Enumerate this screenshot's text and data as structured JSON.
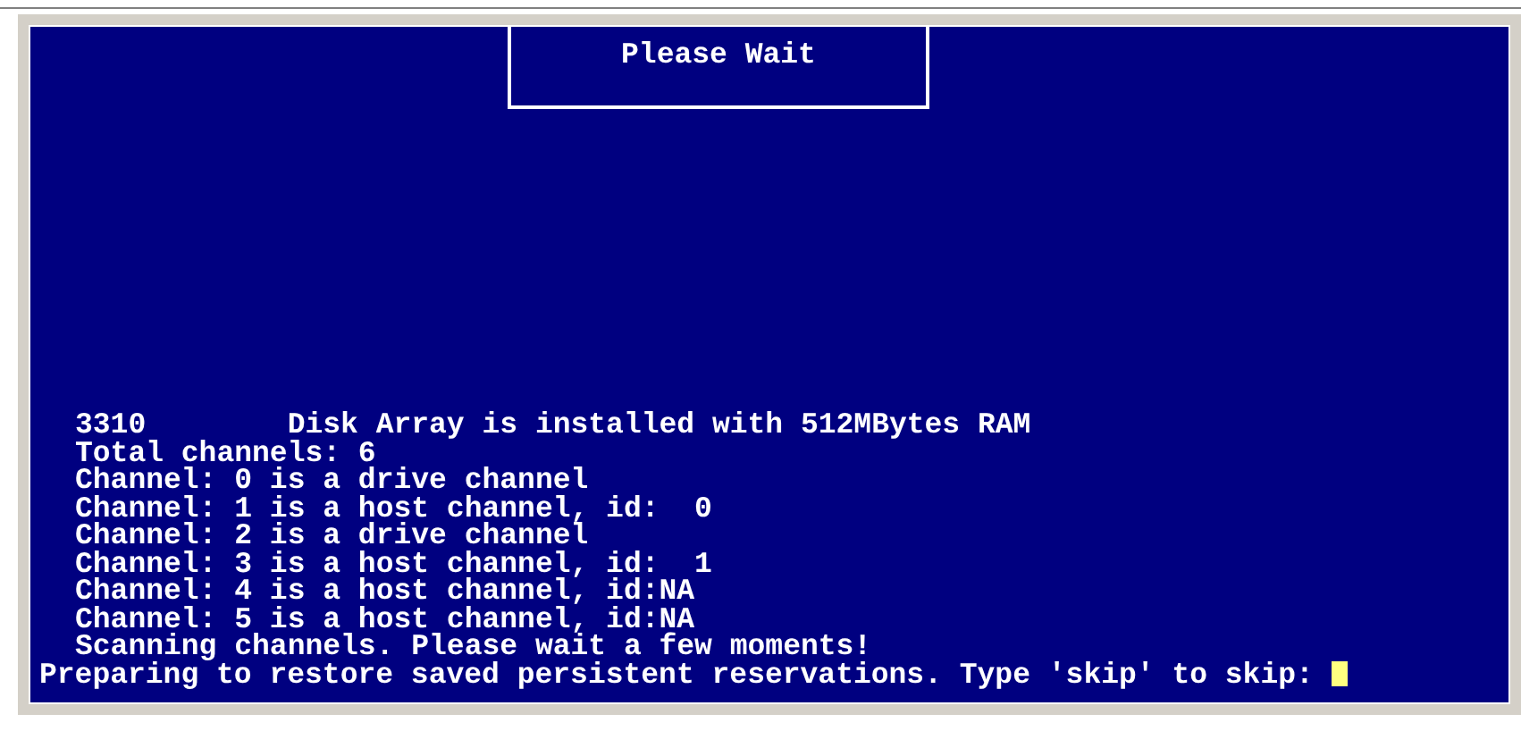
{
  "dialog": {
    "title": "Please Wait"
  },
  "console_lines": [
    {
      "text": "3310        Disk Array is installed with 512MBytes RAM",
      "indent": true
    },
    {
      "text": "Total channels: 6",
      "indent": true
    },
    {
      "text": "Channel: 0 is a drive channel",
      "indent": true
    },
    {
      "text": "Channel: 1 is a host channel, id:  0",
      "indent": true
    },
    {
      "text": "Channel: 2 is a drive channel",
      "indent": true
    },
    {
      "text": "Channel: 3 is a host channel, id:  1",
      "indent": true
    },
    {
      "text": "Channel: 4 is a host channel, id:NA",
      "indent": true
    },
    {
      "text": "Channel: 5 is a host channel, id:NA",
      "indent": true
    },
    {
      "text": "Scanning channels. Please wait a few moments!",
      "indent": true
    }
  ],
  "prompt": {
    "text": "Preparing to restore saved persistent reservations. Type 'skip' to skip: "
  }
}
